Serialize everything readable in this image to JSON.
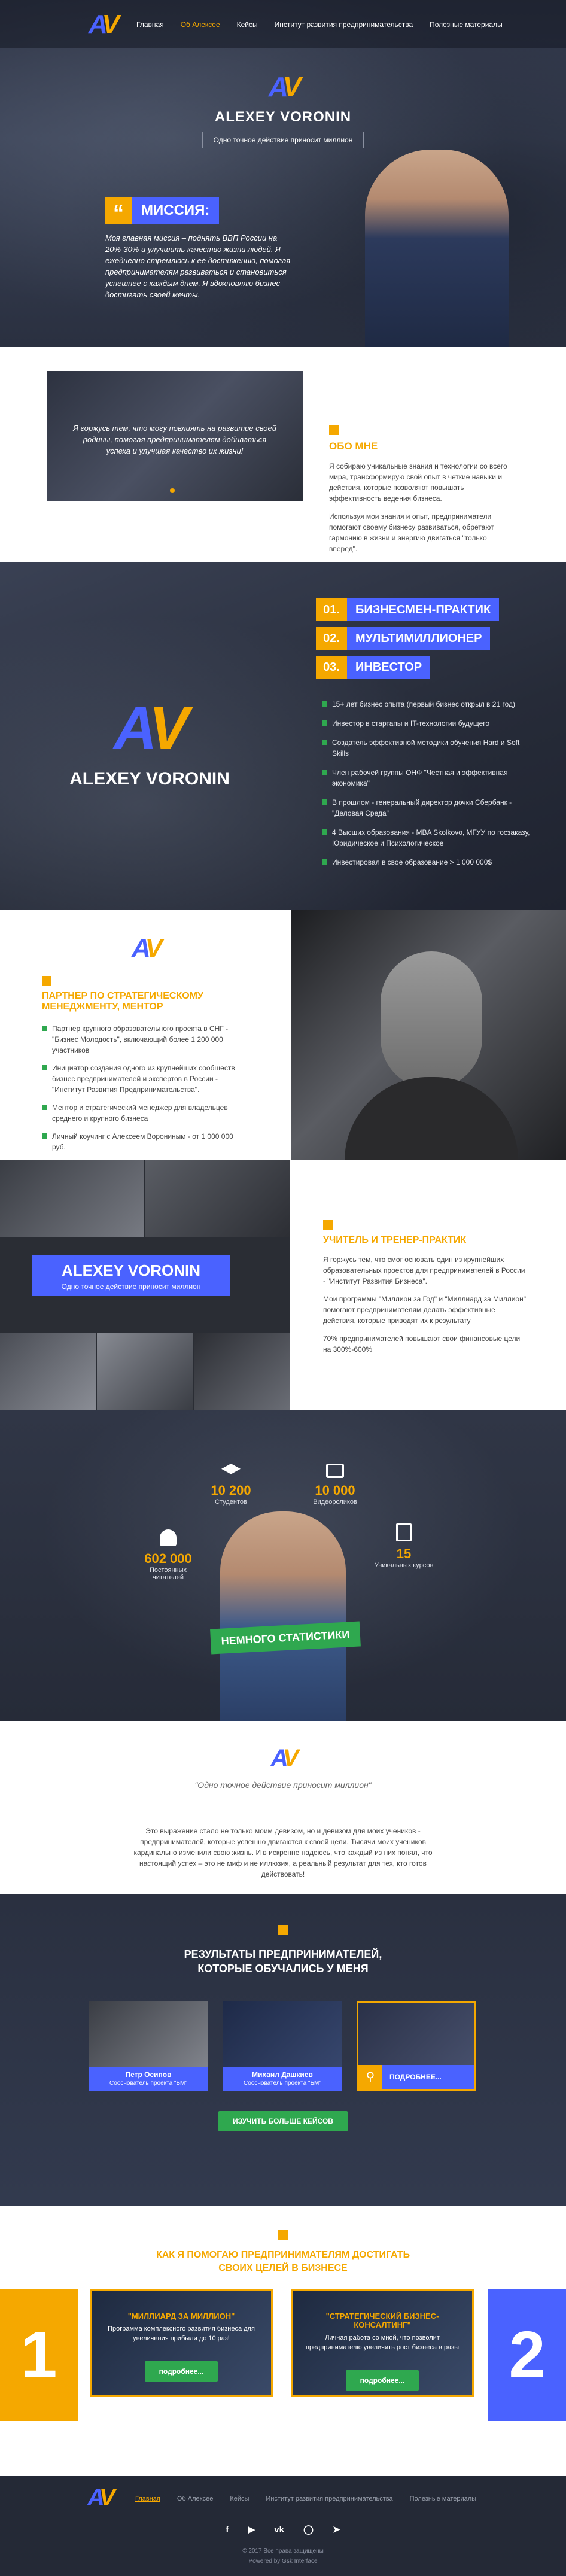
{
  "nav": {
    "items": [
      "Главная",
      "Об Алексее",
      "Кейсы",
      "Институт развития предпринимательства",
      "Полезные материалы"
    ],
    "active_index": 1
  },
  "hero": {
    "name": "ALEXEY VORONIN",
    "tagline": "Одно точное действие приносит миллион",
    "mission_label": "МИССИЯ:",
    "mission_text": "Моя главная миссия – поднять ВВП России на 20%-30% и улучшить качество жизни людей. Я ежедневно стремлюсь к её достижению, помогая предпринимателям развиваться и становиться успешнее с каждым днем. Я вдохновляю бизнес достигать своей мечты."
  },
  "about": {
    "quote": "Я горжусь тем, что могу повлиять на развитие своей родины, помогая предпринимателям добиваться успеха и улучшая качество их жизни!",
    "title": "ОБО МНЕ",
    "paragraphs": [
      "Я собираю уникальные знания и технологии со всего мира, трансформирую свой опыт в четкие навыки и действия, которые позволяют повышать эффективность ведения бизнеса.",
      "Используя мои знания и опыт, предприниматели помогают своему бизнесу развиваться, обретают гармонию в жизни и энергию двигаться \"только вперед\"."
    ]
  },
  "roles": {
    "name": "ALEXEY VORONIN",
    "badges": [
      {
        "num": "01.",
        "label": "БИЗНЕСМЕН-ПРАКТИК"
      },
      {
        "num": "02.",
        "label": "МУЛЬТИМИЛЛИОНЕР"
      },
      {
        "num": "03.",
        "label": "ИНВЕСТОР"
      }
    ],
    "facts": [
      "15+ лет бизнес опыта (первый бизнес открыл в 21 год)",
      "Инвестор в стартапы и IT-технологии будущего",
      "Создатель эффективной методики обучения Hard и Soft Skills",
      "Член рабочей группы ОНФ \"Честная и эффективная экономика\"",
      "В прошлом - генеральный директор дочки Сбербанк - \"Деловая Среда\"",
      "4 Высших образования - MBA Skolkovo, МГУУ по госзаказу, Юридическое и Психологическое",
      "Инвестировал в свое образование > 1 000 000$"
    ]
  },
  "partner": {
    "title": "ПАРТНЕР ПО СТРАТЕГИЧЕСКОМУ МЕНЕДЖМЕНТУ, МЕНТОР",
    "items": [
      "Партнер крупного образовательного проекта в СНГ - \"Бизнес Молодость\", включающий более 1 200 000 участников",
      "Инициатор создания одного из крупнейших сообществ бизнес предпринимателей и экспертов в России - \"Институт Развития Предпринимательства\".",
      "Ментор и стратегический менеджер для владельцев среднего и крупного бизнеса",
      "Личный коучинг с Алексеем Ворониным - от 1 000 000 руб."
    ]
  },
  "teacher": {
    "banner_name": "ALEXEY VORONIN",
    "banner_tagline": "Одно точное действие приносит миллион",
    "title": "УЧИТЕЛЬ И ТРЕНЕР-ПРАКТИК",
    "paragraphs": [
      "Я горжусь тем, что смог основать один из крупнейших образовательных проектов для предпринимателей в России - \"Институт Развития Бизнеса\".",
      "Мои программы \"Миллион за Год\" и \"Миллиард за Миллион\" помогают предпринимателям делать эффективные действия, которые приводят их к результату",
      "70% предпринимателей повышают свои финансовые цели на 300%-600%"
    ]
  },
  "stats": {
    "label": "НЕМНОГО СТАТИСТИКИ",
    "items": [
      {
        "num": "10 200",
        "label": "Студентов",
        "icon": "graduation-cap-icon"
      },
      {
        "num": "10 000",
        "label": "Видеороликов",
        "icon": "video-icon"
      },
      {
        "num": "602 000",
        "label": "Постоянных читателей",
        "icon": "readers-icon"
      },
      {
        "num": "15",
        "label": "Уникальных курсов",
        "icon": "courses-icon"
      }
    ]
  },
  "quote_block": {
    "quote": "\"Одно точное действие приносит миллион\"",
    "text": "Это выражение стало не только моим девизом, но и девизом для моих учеников - предпринимателей, которые успешно двигаются к своей цели. Тысячи моих учеников кардинально изменили свою жизнь. И в искренне надеюсь, что каждый из них понял, что настоящий успех – это не миф и не иллюзия, а реальный результат для тех, кто готов действовать!"
  },
  "results": {
    "title": "РЕЗУЛЬТАТЫ ПРЕДПРИНИМАТЕЛЕЙ, КОТОРЫЕ ОБУЧАЛИСЬ У МЕНЯ",
    "cases": [
      {
        "name": "Петр Осипов",
        "role": "Сооснователь проекта \"БМ\""
      },
      {
        "name": "Михаил Дашкиев",
        "role": "Сооснователь проекта \"БМ\""
      }
    ],
    "more_label": "ПОДРОБНЕЕ...",
    "button": "ИЗУЧИТЬ БОЛЬШЕ КЕЙСОВ"
  },
  "programs": {
    "title": "КАК Я ПОМОГАЮ ПРЕДПРИНИМАТЕЛЯМ ДОСТИГАТЬ СВОИХ ЦЕЛЕЙ В БИЗНЕСЕ",
    "items": [
      {
        "num": "1",
        "name": "\"МИЛЛИАРД ЗА МИЛЛИОН\"",
        "desc": "Программа комплексного развития бизнеса для увеличения прибыли до 10 раз!",
        "button": "подробнее..."
      },
      {
        "num": "2",
        "name": "\"СТРАТЕГИЧЕСКИЙ БИЗНЕС-КОНСАЛТИНГ\"",
        "desc": "Личная работа со мной, что позволит предпринимателю увеличить рост бизнеса в разы",
        "button": "подробнее..."
      }
    ]
  },
  "footer": {
    "nav": [
      "Главная",
      "Об Алексее",
      "Кейсы",
      "Институт развития предпринимательства",
      "Полезные материалы"
    ],
    "social": [
      "facebook-icon",
      "youtube-icon",
      "vk-icon",
      "instagram-icon",
      "telegram-icon"
    ],
    "copyright": "© 2017 Все права защищены",
    "credit": "Powered by Gsk Interface"
  },
  "colors": {
    "accent_orange": "#f5a800",
    "accent_blue": "#4a62ff",
    "green": "#2fa84f",
    "dark": "#2a3040"
  }
}
